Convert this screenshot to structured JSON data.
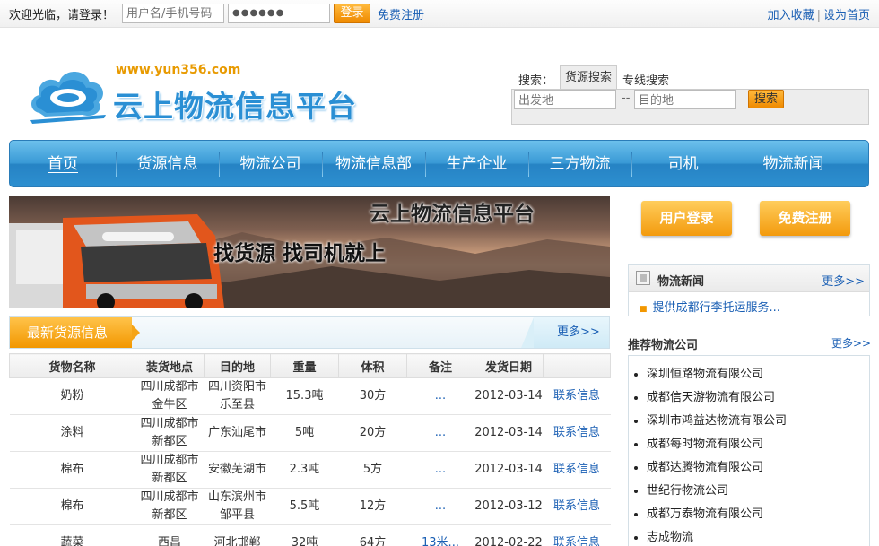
{
  "topbar": {
    "welcome": "欢迎光临，请登录！",
    "username_placeholder": "用户名/手机号码",
    "password_value": "●●●●●●",
    "login_label": "登录",
    "free_register": "免费注册",
    "bookmark": "加入收藏",
    "separator": "|",
    "homepage": "设为首页"
  },
  "header": {
    "url": "www.yun356.com",
    "title": "云上物流信息平台"
  },
  "search": {
    "caption": "搜索：",
    "tab_cargo": "货源搜索",
    "tab_line": "专线搜索",
    "from_placeholder": "出发地",
    "dash": "--",
    "to_placeholder": "目的地",
    "button": "搜索"
  },
  "nav": {
    "items": [
      "首页",
      "货源信息",
      "物流公司",
      "物流信息部",
      "生产企业",
      "三方物流",
      "司机",
      "物流新闻"
    ]
  },
  "banner": {
    "title": "云上物流信息平台",
    "subtitle": "找货源  找司机就上"
  },
  "cargo": {
    "heading": "最新货源信息",
    "more": "更多>>",
    "columns": [
      "货物名称",
      "装货地点",
      "目的地",
      "重量",
      "体积",
      "备注",
      "发货日期",
      ""
    ],
    "rows": [
      {
        "name": "奶粉",
        "from": "四川成都市金牛区",
        "to": "四川资阳市乐至县",
        "weight": "15.3吨",
        "volume": "30方",
        "note": "...",
        "date": "2012-03-14",
        "contact": "联系信息"
      },
      {
        "name": "涂料",
        "from": "四川成都市新都区",
        "to": "广东汕尾市",
        "weight": "5吨",
        "volume": "20方",
        "note": "...",
        "date": "2012-03-14",
        "contact": "联系信息"
      },
      {
        "name": "棉布",
        "from": "四川成都市新都区",
        "to": "安徽芜湖市",
        "weight": "2.3吨",
        "volume": "5方",
        "note": "...",
        "date": "2012-03-14",
        "contact": "联系信息"
      },
      {
        "name": "棉布",
        "from": "四川成都市新都区",
        "to": "山东滨州市邹平县",
        "weight": "5.5吨",
        "volume": "12方",
        "note": "...",
        "date": "2012-03-12",
        "contact": "联系信息"
      },
      {
        "name": "蔬菜",
        "from": "西昌",
        "to": "河北邯郸",
        "weight": "32吨",
        "volume": "64方",
        "note": "13米...",
        "date": "2012-02-22",
        "contact": "联系信息"
      }
    ]
  },
  "sidebar": {
    "user_login": "用户登录",
    "free_register": "免费注册",
    "news_title": "物流新闻",
    "news_more": "更多>>",
    "news_items": [
      "提供成都行李托运服务..."
    ],
    "recommend_title": "推荐物流公司",
    "recommend_more": "更多>>",
    "companies": [
      "深圳恒路物流有限公司",
      "成都信天游物流有限公司",
      "深圳市鸿益达物流有限公司",
      "成都每时物流有限公司",
      "成都达腾物流有限公司",
      "世纪行物流公司",
      "成都万泰物流有限公司",
      "志成物流"
    ]
  },
  "colors": {
    "accent_orange": "#f29700",
    "nav_blue": "#2d8fd0",
    "link_blue": "#1a5fb4",
    "logo_blue": "#2a8fd4"
  }
}
